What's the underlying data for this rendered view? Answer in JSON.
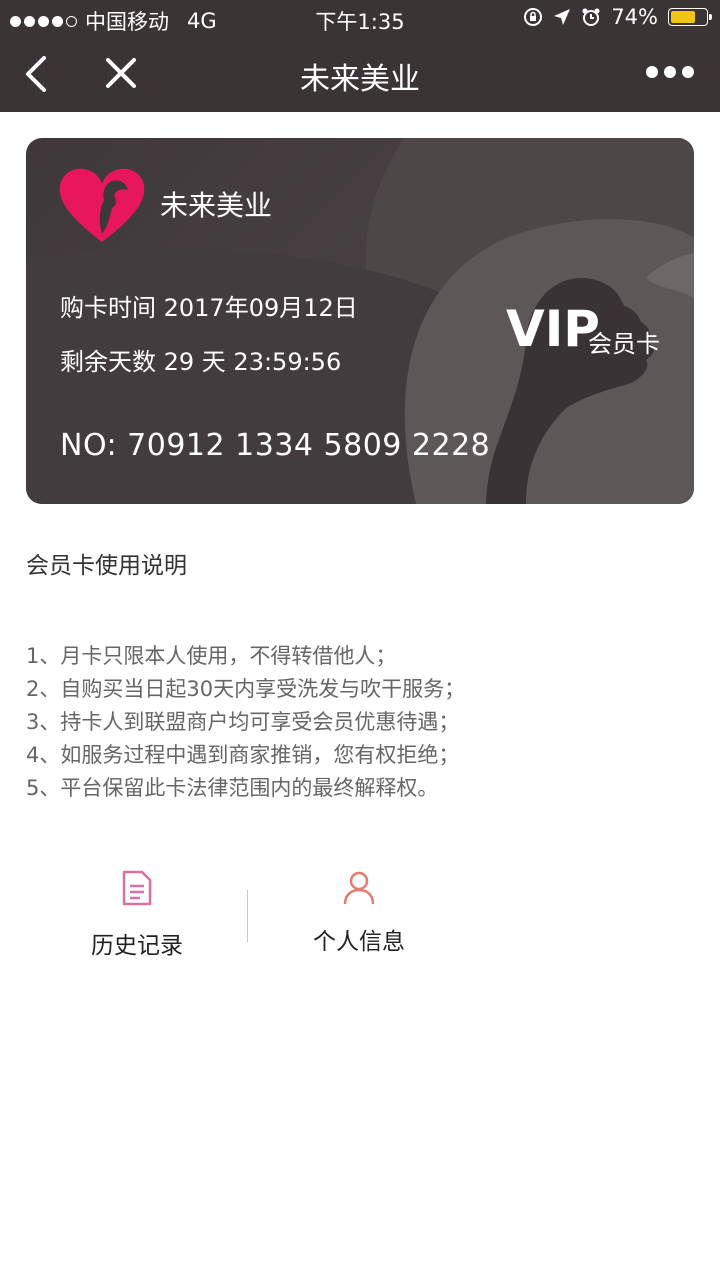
{
  "status_bar": {
    "carrier": "中国移动",
    "network": "4G",
    "time": "下午1:35",
    "battery": "74%",
    "battery_level": 0.74,
    "battery_color": "#f4c50f"
  },
  "navbar": {
    "title": "未来美业",
    "back_icon": "chevron-left-icon",
    "close_icon": "close-icon",
    "more_icon": "more-dots-icon",
    "background": "#3b3435"
  },
  "card": {
    "brand_name": "未来美业",
    "purchase_line": "购卡时间 2017年09月12日",
    "remaining_line": "剩余天数 29 天 23:59:56",
    "card_number": "NO: 70912 1334 5809 2228",
    "vip_label": "VIP",
    "vip_sub": "会员卡",
    "logo_color": "#e8175d"
  },
  "instructions": {
    "title": "会员卡使用说明",
    "items": [
      "1、月卡只限本人使用，不得转借他人；",
      "2、自购买当日起30天内享受洗发与吹干服务；",
      "3、持卡人到联盟商户均可享受会员优惠待遇；",
      "4、如服务过程中遇到商家推销，您有权拒绝；",
      "5、平台保留此卡法律范围内的最终解释权。"
    ]
  },
  "actions": {
    "history": {
      "label": "历史记录",
      "icon": "document-icon",
      "color": "#d86fa8"
    },
    "profile": {
      "label": "个人信息",
      "icon": "person-icon",
      "color": "#e87a6e"
    }
  }
}
